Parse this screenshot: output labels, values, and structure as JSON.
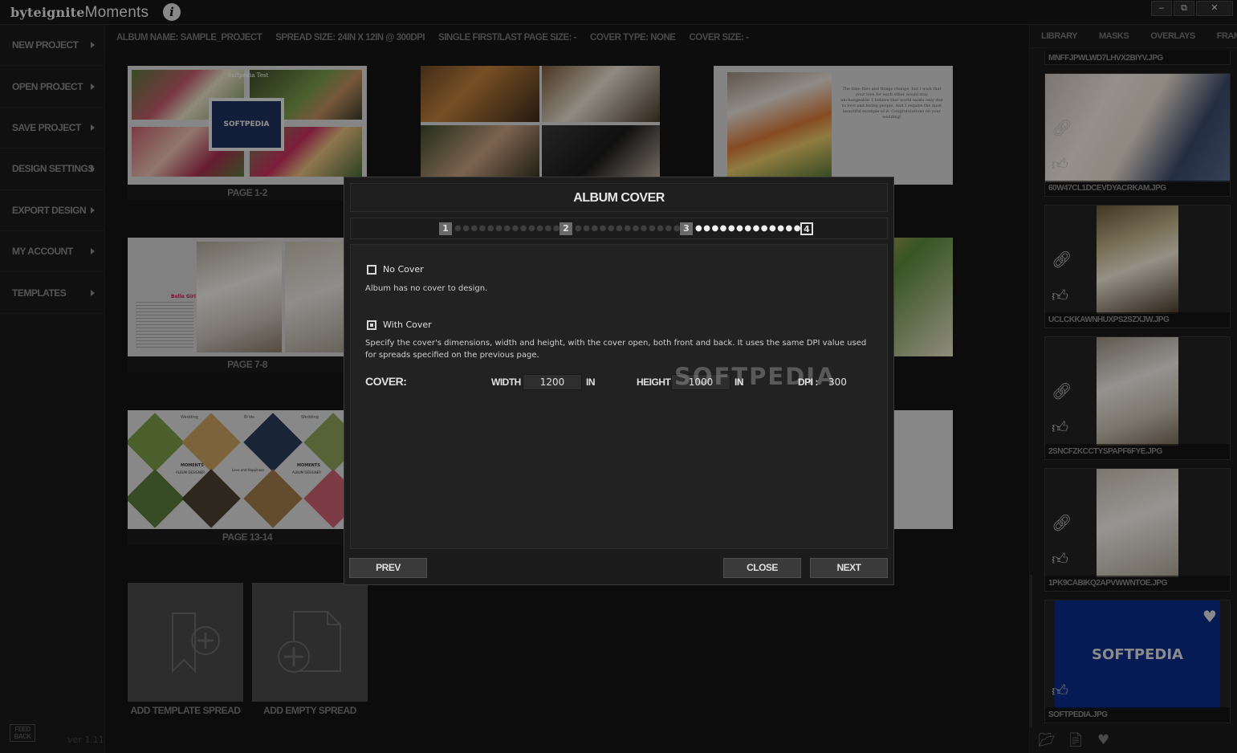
{
  "app": {
    "logo_bold": "byteignite",
    "logo_light": "Moments",
    "info_icon": "info-icon",
    "window_buttons": [
      "‒",
      "⧉",
      "✕"
    ]
  },
  "sidebar": {
    "items": [
      {
        "label": "NEW PROJECT"
      },
      {
        "label": "OPEN PROJECT"
      },
      {
        "label": "SAVE PROJECT"
      },
      {
        "label": "DESIGN SETTINGS"
      },
      {
        "label": "EXPORT DESIGN"
      },
      {
        "label": "MY ACCOUNT"
      },
      {
        "label": "TEMPLATES"
      }
    ],
    "feedback": "FEED BACK",
    "version": "ver 1.11"
  },
  "infobar": {
    "album_name": "ALBUM NAME: SAMPLE_PROJECT",
    "spread_size": "SPREAD SIZE: 24IN X 12IN @ 300DPI",
    "single_page": "SINGLE FIRST/LAST PAGE SIZE: -",
    "cover_type": "COVER TYPE: NONE",
    "cover_size": "COVER SIZE: -"
  },
  "spreads": [
    {
      "caption": "PAGE 1-2"
    },
    {
      "caption": "PAGE 7-8"
    },
    {
      "caption": "PAGE 13-14"
    }
  ],
  "thumb_text": {
    "softpedia": "SOFTPEDIA",
    "softpedia_test": "Softpedia Test",
    "belle_girl": "Belle Girl",
    "wedding": "Wedding",
    "bride": "Bride",
    "moments": "MOMENTS",
    "album_designer": "ALBUM DESIGNER",
    "love_happiness": "Love and Happiness",
    "letter_text": "The time flies and things change, but I wish that your love for each other would stay unchangeable. I believe that world exists only due to love and loving people. And I require the most beautiful example of it. Congratulations on your wedding!"
  },
  "add_tiles": {
    "template": "ADD TEMPLATE SPREAD",
    "empty": "ADD EMPTY SPREAD"
  },
  "right_panel": {
    "tabs": [
      "LIBRARY",
      "MASKS",
      "OVERLAYS",
      "FRAMES"
    ],
    "top_partial_name": "MNFFJPWLWD7LHVX2BIYV.JPG",
    "items": [
      {
        "filename": "60W47CL1DCEVDYACRKAM.JPG"
      },
      {
        "filename": "UCLCKKAWNHUXPS2SZXJW.JPG"
      },
      {
        "filename": "2SNCFZKCCTYSPAPF6FYE.JPG"
      },
      {
        "filename": "1PK9CABIKQ2APVWWNTOE.JPG"
      },
      {
        "filename": "SOFTPEDIA.JPG",
        "logo": "SOFTPEDIA"
      }
    ]
  },
  "modal": {
    "title": "ALBUM COVER",
    "steps": [
      "1",
      "2",
      "3",
      "4"
    ],
    "no_cover_label": "No Cover",
    "no_cover_desc": "Album has no cover to design.",
    "with_cover_label": "With Cover",
    "with_cover_desc": "Specify the cover's dimensions, width and height, with the cover open, both front and back. It uses the same DPI value used for spreads specified on the previous page.",
    "cover_label": "COVER:",
    "width_label": "WIDTH :",
    "width_value": "1200",
    "width_unit": "IN",
    "height_label": "HEIGHT :",
    "height_value": "1000",
    "height_unit": "IN",
    "dpi_label": "DPI :",
    "dpi_value": "300",
    "prev": "PREV",
    "close": "CLOSE",
    "next": "NEXT"
  },
  "watermark": "SOFTPEDIA"
}
